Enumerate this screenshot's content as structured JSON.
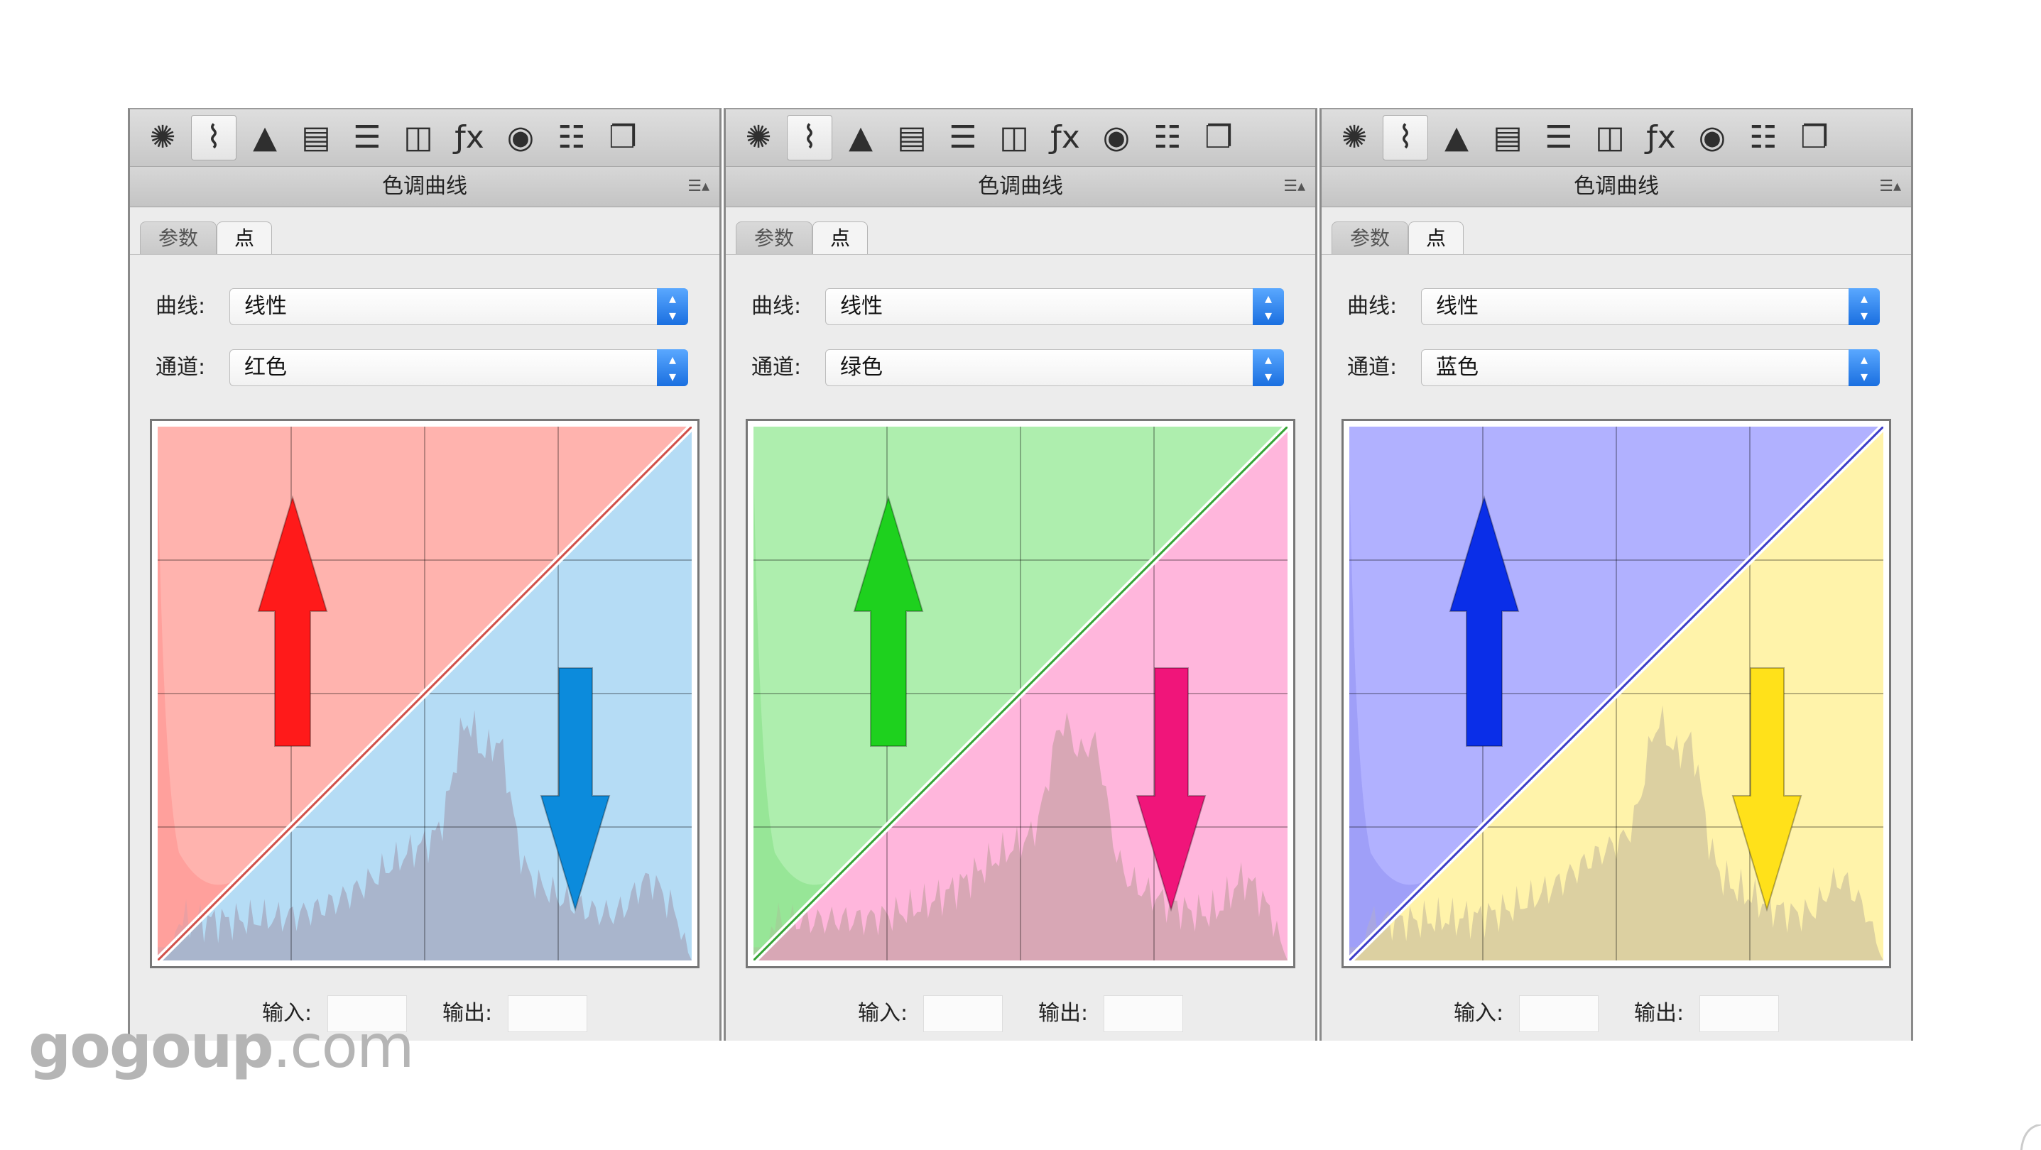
{
  "panels": [
    {
      "title": "色调曲线",
      "tabs": [
        "参数",
        "点"
      ],
      "curve_label": "曲线:",
      "curve_value": "线性",
      "channel_label": "通道:",
      "channel_value": "红色",
      "input_label": "输入:",
      "output_label": "输出:",
      "upper_color": "#ffb3ae",
      "lower_color": "#b5dcf5",
      "hist_color": "#a7b0c8",
      "hist_left_color": "#ff9a96",
      "up_arrow_color": "#ff1a1a",
      "down_arrow_color": "#0c8bdc",
      "line_color": "#d0504a"
    },
    {
      "title": "色调曲线",
      "tabs": [
        "参数",
        "点"
      ],
      "curve_label": "曲线:",
      "curve_value": "线性",
      "channel_label": "通道:",
      "channel_value": "绿色",
      "input_label": "输入:",
      "output_label": "输出:",
      "upper_color": "#aeeeae",
      "lower_color": "#ffb6dc",
      "hist_color": "#d4a5b0",
      "hist_left_color": "#8fe38f",
      "up_arrow_color": "#1ed11e",
      "down_arrow_color": "#f0157a",
      "line_color": "#35a335"
    },
    {
      "title": "色调曲线",
      "tabs": [
        "参数",
        "点"
      ],
      "curve_label": "曲线:",
      "curve_value": "线性",
      "channel_label": "通道:",
      "channel_value": "蓝色",
      "input_label": "输入:",
      "output_label": "输出:",
      "upper_color": "#b1b1ff",
      "lower_color": "#fff3aa",
      "hist_color": "#d8cca0",
      "hist_left_color": "#9a9af5",
      "up_arrow_color": "#0a2ee8",
      "down_arrow_color": "#ffe11a",
      "line_color": "#3c3cc8"
    }
  ],
  "toolbar_icons": [
    "aperture-icon",
    "tone-curve-icon",
    "detail-icon",
    "hsl-icon",
    "split-toning-icon",
    "lens-correction-icon",
    "effects-icon",
    "camera-calibration-icon",
    "presets-icon",
    "snapshots-icon"
  ],
  "watermark": {
    "bold": "gogoup",
    "thin": ".com"
  }
}
